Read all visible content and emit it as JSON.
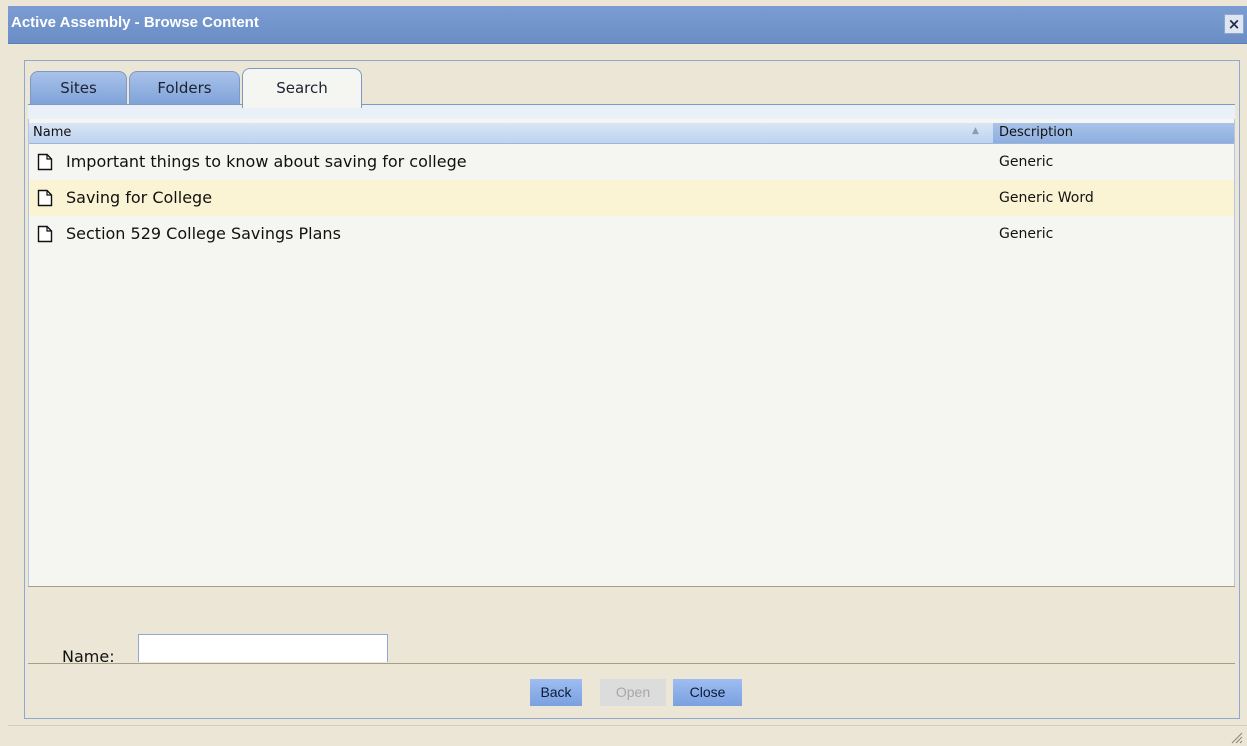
{
  "window": {
    "title": "Active Assembly - Browse Content",
    "close_symbol": "×"
  },
  "tabs": [
    {
      "label": "Sites",
      "active": false
    },
    {
      "label": "Folders",
      "active": false
    },
    {
      "label": "Search",
      "active": true
    }
  ],
  "table": {
    "columns": {
      "name": "Name",
      "description": "Description"
    },
    "sort_column": "Name",
    "rows": [
      {
        "name": "Important things to know about saving for college",
        "description": "Generic",
        "icon": "document-icon",
        "highlighted": false
      },
      {
        "name": "Saving for College",
        "description": "Generic Word",
        "icon": "document-icon",
        "highlighted": true
      },
      {
        "name": "Section 529 College Savings Plans",
        "description": "Generic",
        "icon": "document-icon",
        "highlighted": false
      }
    ]
  },
  "form": {
    "name_label": "Name:",
    "name_value": ""
  },
  "buttons": {
    "back": "Back",
    "open": "Open",
    "close": "Close"
  },
  "colors": {
    "titlebar": "#7b9dd2",
    "accent_button": "#8fb0e8",
    "highlight_row": "#fbf4d4",
    "dialog_background": "#ece6d7"
  }
}
